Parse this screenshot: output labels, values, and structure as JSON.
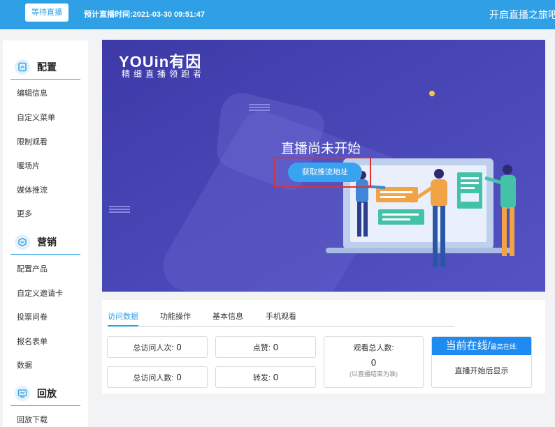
{
  "header": {
    "status_label": "等待直播",
    "plan_time": "预计直播时间:2021-03-30 09:51:47",
    "slogan": "开启直播之旅吧"
  },
  "sidebar": {
    "sections": [
      {
        "title": "配置",
        "icon": "config-icon",
        "items": [
          "编辑信息",
          "自定义菜单",
          "限制观看",
          "暖场片",
          "媒体推流",
          "更多"
        ]
      },
      {
        "title": "营销",
        "icon": "marketing-icon",
        "items": [
          "配置产品",
          "自定义邀请卡",
          "投票问卷",
          "报名表单",
          "数据"
        ]
      },
      {
        "title": "回放",
        "icon": "playback-icon",
        "items": [
          "回放下载"
        ]
      }
    ]
  },
  "banner": {
    "logo_main": "YOUin有因",
    "logo_sub": "精细直播领跑者",
    "status_text": "直播尚未开始",
    "button_label": "获取推流地址"
  },
  "panel": {
    "tabs": [
      "访问数据",
      "功能操作",
      "基本信息",
      "手机观看"
    ],
    "active_tab": 0,
    "stats": {
      "total_visits_label": "总访问人次:",
      "total_visits": "0",
      "likes_label": "点赞:",
      "likes": "0",
      "total_visitors_label": "总访问人数:",
      "total_visitors": "0",
      "shares_label": "转发:",
      "shares": "0",
      "viewers_label": "观看总人数:",
      "viewers": "0",
      "viewers_note": "(以直播结束为准)"
    },
    "online": {
      "title": "当前在线/",
      "title_suffix": "最高在线:",
      "note": "直播开始后显示"
    }
  },
  "colors": {
    "accent": "#2f9fe6",
    "banner_bg": "#4a47b4",
    "highlight": "#e0302d"
  }
}
